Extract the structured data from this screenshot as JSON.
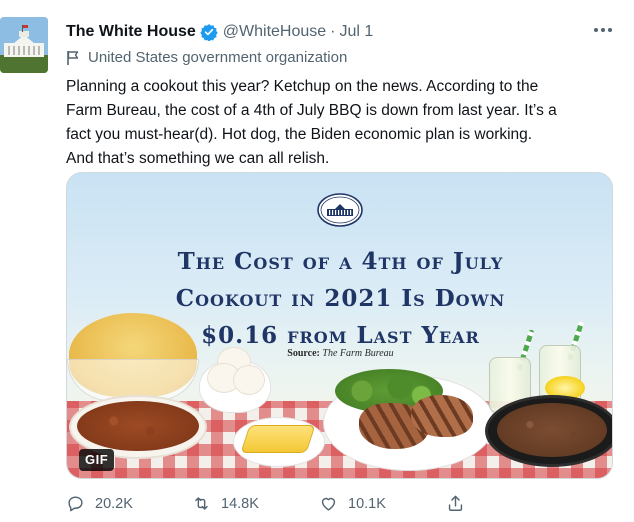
{
  "tweet": {
    "author_name": "The White House",
    "handle": "@WhiteHouse",
    "separator": "·",
    "date": "Jul 1",
    "affiliation": "United States government organization",
    "text_lines": [
      "Planning a cookout this year? Ketchup on the news. According to the",
      "Farm Bureau, the cost of a 4th of July BBQ is down from last year. It’s a",
      "fact you must-hear(d). Hot dog, the Biden economic plan is working.",
      "And that’s something we can all relish."
    ]
  },
  "media": {
    "headline_lines": [
      "The Cost of a 4th of July",
      "Cookout in 2021 Is Down",
      "$0.16 from Last Year"
    ],
    "source_label": "Source:",
    "source_name": "The Farm Bureau",
    "badge": "GIF"
  },
  "actions": {
    "replies": "20.2K",
    "retweets": "14.8K",
    "likes": "10.1K"
  },
  "icons": [
    "verified-badge-icon",
    "more-options-icon",
    "flag-icon",
    "reply-icon",
    "retweet-icon",
    "like-icon",
    "share-icon"
  ],
  "colors": {
    "verified_blue": "#1d9bf0",
    "secondary_text": "#536471",
    "headline_navy": "#1f3566"
  }
}
